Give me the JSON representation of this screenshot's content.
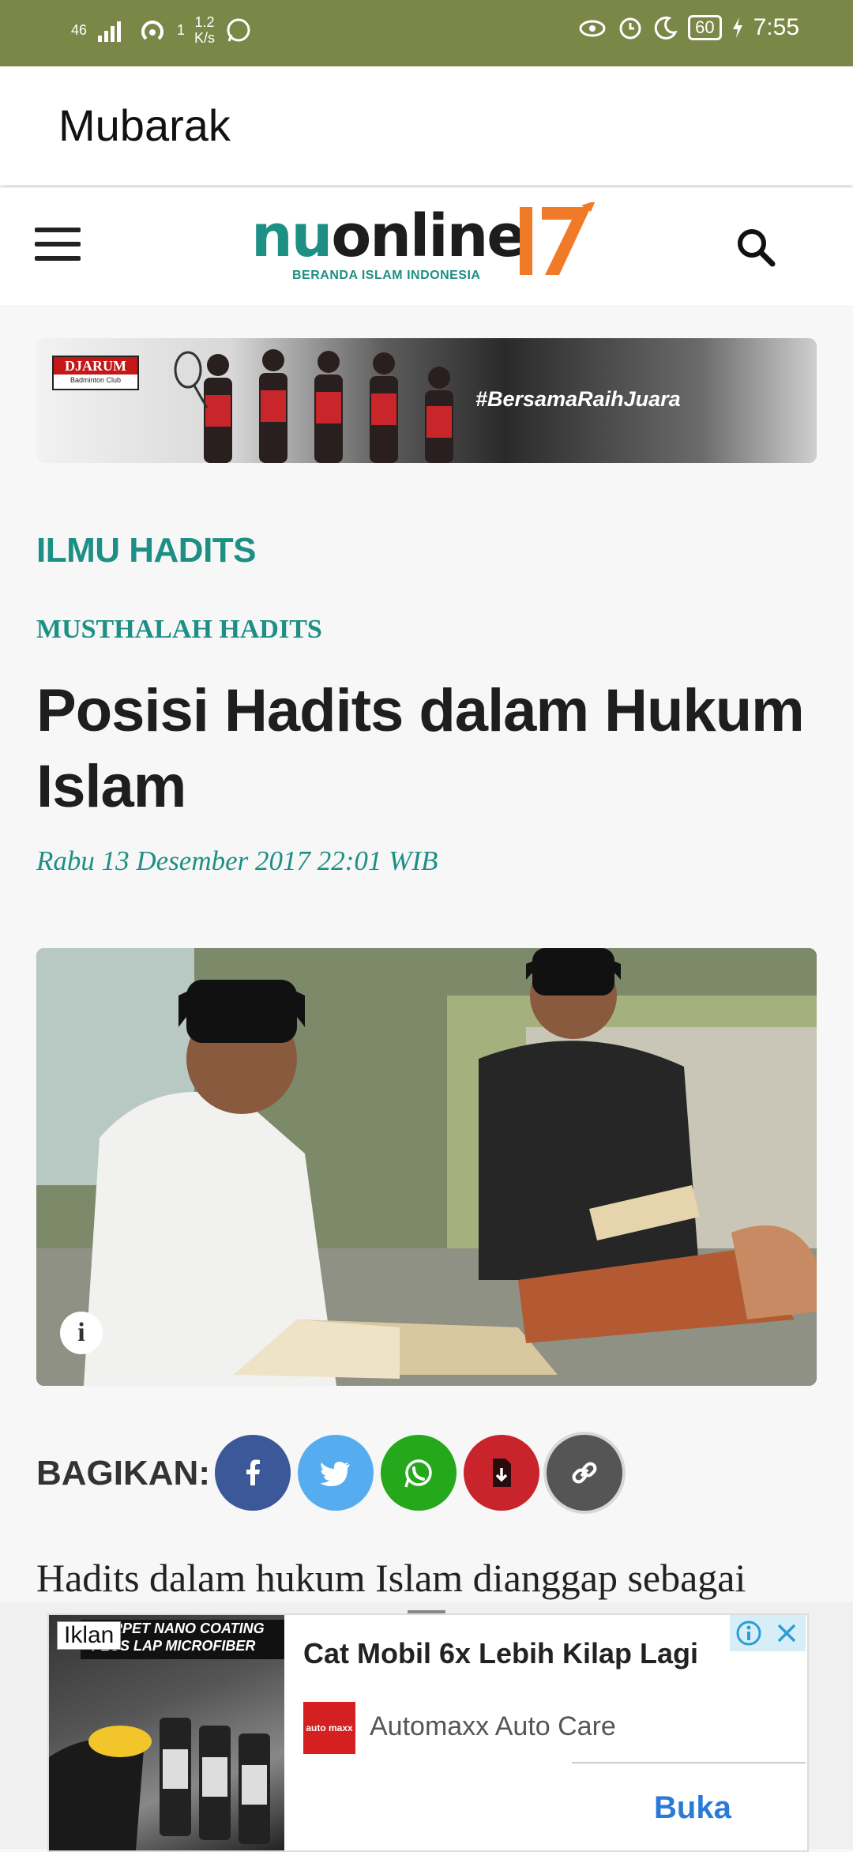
{
  "status_bar": {
    "network": "46",
    "sim_slot": "1",
    "speed_value": "1.2",
    "speed_unit": "K/s",
    "battery": "60",
    "time": "7:55"
  },
  "app_bar": {
    "title": "Mubarak"
  },
  "site_header": {
    "logo_nu": "nu",
    "logo_online": "online",
    "logo_tagline": "BERANDA ISLAM INDONESIA",
    "logo_number": "17"
  },
  "banner": {
    "sponsor_name": "DJARUM",
    "sponsor_sub": "Badminton Club",
    "hashtag": "#BersamaRaihJuara"
  },
  "article": {
    "category": "ILMU HADITS",
    "subcategory": "MUSTHALAH HADITS",
    "headline": "Posisi Hadits dalam Hukum Islam",
    "date": "Rabu 13 Desember 2017 22:01 WIB",
    "body_start": "Hadits dalam hukum Islam dianggap sebagai"
  },
  "share": {
    "label": "BAGIKAN:",
    "buttons": [
      {
        "name": "facebook",
        "color": "#3b5998"
      },
      {
        "name": "twitter",
        "color": "#55acee"
      },
      {
        "name": "whatsapp",
        "color": "#25a81c"
      },
      {
        "name": "pdf",
        "color": "#c9242b"
      },
      {
        "name": "link",
        "color": "#555555"
      }
    ]
  },
  "ad": {
    "label": "Iklan",
    "image_caption_1": "CARPET NANO COATING",
    "image_caption_2": "PLUS LAP MICROFIBER",
    "title": "Cat Mobil 6x Lebih Kilap Lagi",
    "brand": "Automaxx Auto Care",
    "brand_logo_text": "auto maxx",
    "cta": "Buka"
  },
  "colors": {
    "status_bar": "#7a8746",
    "accent_teal": "#1d8f84",
    "logo_orange": "#f07a28",
    "cta_blue": "#2a7ad8"
  }
}
